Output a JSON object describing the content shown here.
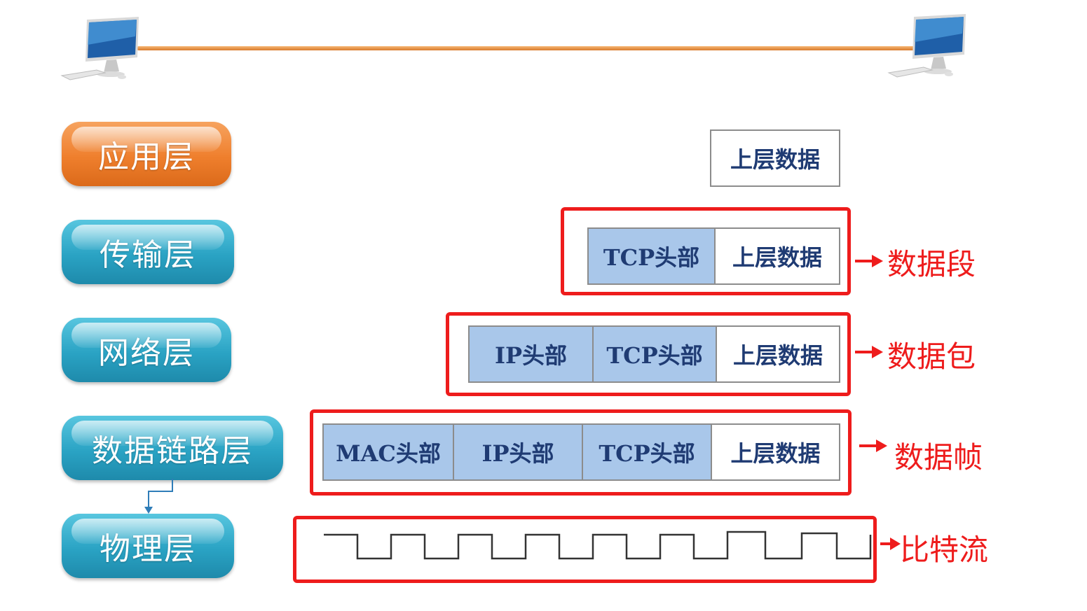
{
  "layers": [
    {
      "key": "app",
      "label": "应用层"
    },
    {
      "key": "transport",
      "label": "传输层"
    },
    {
      "key": "network",
      "label": "网络层"
    },
    {
      "key": "datalink",
      "label": "数据链路层"
    },
    {
      "key": "physical",
      "label": "物理层"
    }
  ],
  "headers": {
    "mac": "MAC头部",
    "ip": "IP头部",
    "tcp": "TCP头部",
    "upper_data": "上层数据"
  },
  "units": {
    "segment": "数据段",
    "packet": "数据包",
    "frame": "数据帧",
    "bitstream": "比特流"
  },
  "colors": {
    "accent_red": "#ee1c1c",
    "header_fill": "#a9c7ea",
    "layer_blue": "#2aa3c4",
    "layer_orange": "#ef7f2d",
    "cable": "#e08a3a"
  },
  "icons": [
    "desktop-computer-icon",
    "desktop-computer-icon"
  ]
}
